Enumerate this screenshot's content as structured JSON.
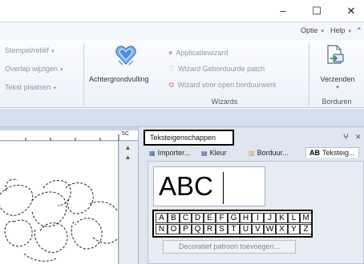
{
  "window": {
    "minimize_glyph": "–",
    "maximize_glyph": "☐",
    "close_glyph": "✕"
  },
  "option_row": {
    "options_label": "Optie",
    "help_label": "Help",
    "caret": "▾",
    "extra_caret": "⌃"
  },
  "ribbon": {
    "left_items": [
      {
        "label": "Stempel/reliëf"
      },
      {
        "label": "Overlap wijzigen"
      },
      {
        "label": "Tekst plaatsen"
      }
    ],
    "background_fill": {
      "label": "Achtergrondvulling",
      "icon": "quilting-heart-icon"
    },
    "wizards": [
      {
        "label": "Applicatiewizard",
        "icon": "heart-icon"
      },
      {
        "label": "Wizard Geborduurde patch",
        "icon": "heart-outline-icon"
      },
      {
        "label": "Wizard voor open borduurwerk",
        "icon": "flower-icon"
      }
    ],
    "wizards_group_label": "Wizards",
    "send": {
      "label": "Verzenden",
      "icon": "send-document-icon"
    },
    "embroidery_group_label": "Borduren",
    "caret": "▾"
  },
  "ruler": {
    "mark_label": "5C"
  },
  "text_panel": {
    "title": "Teksteigenschappen",
    "pin_glyph": "ⵖ",
    "close_glyph": "✕",
    "tabs": [
      {
        "label": "Importer...",
        "icon": "import-icon"
      },
      {
        "label": "Kleur",
        "icon": "color-icon"
      },
      {
        "label": "Borduur...",
        "icon": "embroidery-icon"
      },
      {
        "label": "Teksteig...",
        "icon": "text-properties-icon",
        "icon_text": "AB"
      }
    ],
    "preview_text": "ABC",
    "char_rows": [
      [
        "A",
        "B",
        "C",
        "D",
        "E",
        "F",
        "G",
        "H",
        "I",
        "J",
        "K",
        "L",
        "M"
      ],
      [
        "N",
        "O",
        "P",
        "Q",
        "R",
        "S",
        "T",
        "U",
        "V",
        "W",
        "X",
        "Y",
        "Z"
      ]
    ],
    "decorative_button": "Decoratief patroon toevoegen..."
  }
}
